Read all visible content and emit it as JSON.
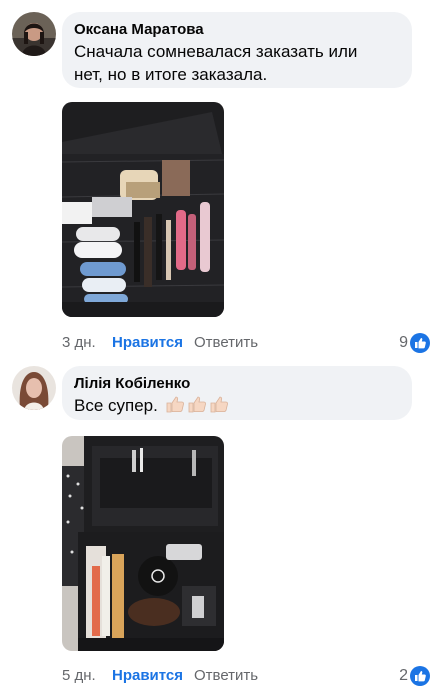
{
  "comments": [
    {
      "author": "Оксана Маратова",
      "text_lines": [
        "Сначала сомневалася заказать или",
        "нет, но в итоге заказала."
      ],
      "time": "3 дн.",
      "like_label": "Нравится",
      "reply_label": "Ответить",
      "reaction_count": "9",
      "reaction_icon": "thumbs-up-icon"
    },
    {
      "author": "Лілія Кобіленко",
      "text": "Все супер.",
      "emoji_icon": "thumbs-up-emoji",
      "emoji_count": 3,
      "time": "5 дн.",
      "like_label": "Нравится",
      "reply_label": "Ответить",
      "reaction_count": "2",
      "reaction_icon": "thumbs-up-icon"
    }
  ],
  "colors": {
    "bubble": "#f0f2f5",
    "like_blue": "#1b74e4",
    "meta_gray": "#65676b"
  }
}
